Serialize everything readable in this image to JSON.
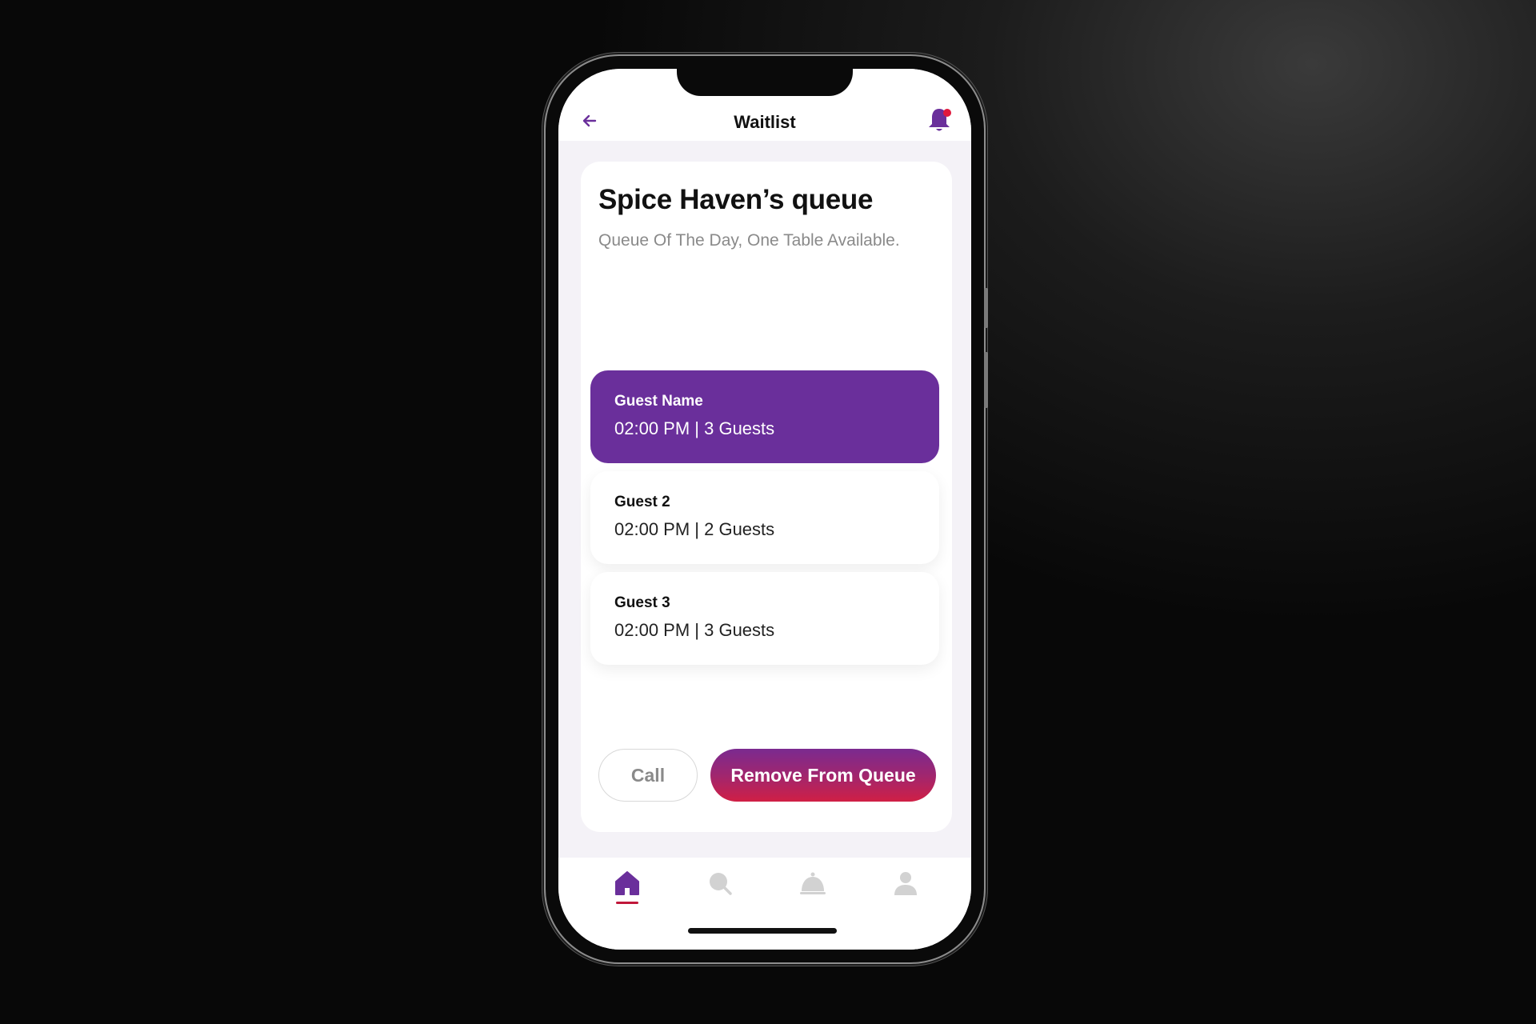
{
  "header": {
    "title": "Waitlist",
    "back_icon": "arrow-left-icon",
    "notification_icon": "bell-icon",
    "accent_color": "#6a2f9b",
    "badge_color": "#e0183c"
  },
  "queue": {
    "title": "Spice Haven’s queue",
    "subtitle": "Queue Of The Day, One Table Available."
  },
  "guests": [
    {
      "name": "Guest Name",
      "info": "02:00 PM | 3 Guests",
      "selected": true
    },
    {
      "name": "Guest 2",
      "info": "02:00 PM | 2 Guests",
      "selected": false
    },
    {
      "name": "Guest 3",
      "info": "02:00 PM | 3 Guests",
      "selected": false
    }
  ],
  "actions": {
    "call_label": "Call",
    "remove_label": "Remove From Queue",
    "remove_gradient": [
      "#7a2a90",
      "#d01f45"
    ]
  },
  "nav": {
    "items": [
      {
        "icon": "home-icon",
        "active": true
      },
      {
        "icon": "search-icon",
        "active": false
      },
      {
        "icon": "service-bell-icon",
        "active": false
      },
      {
        "icon": "user-icon",
        "active": false
      }
    ],
    "active_color": "#6a2f9b",
    "inactive_color": "#cfcfcf"
  }
}
